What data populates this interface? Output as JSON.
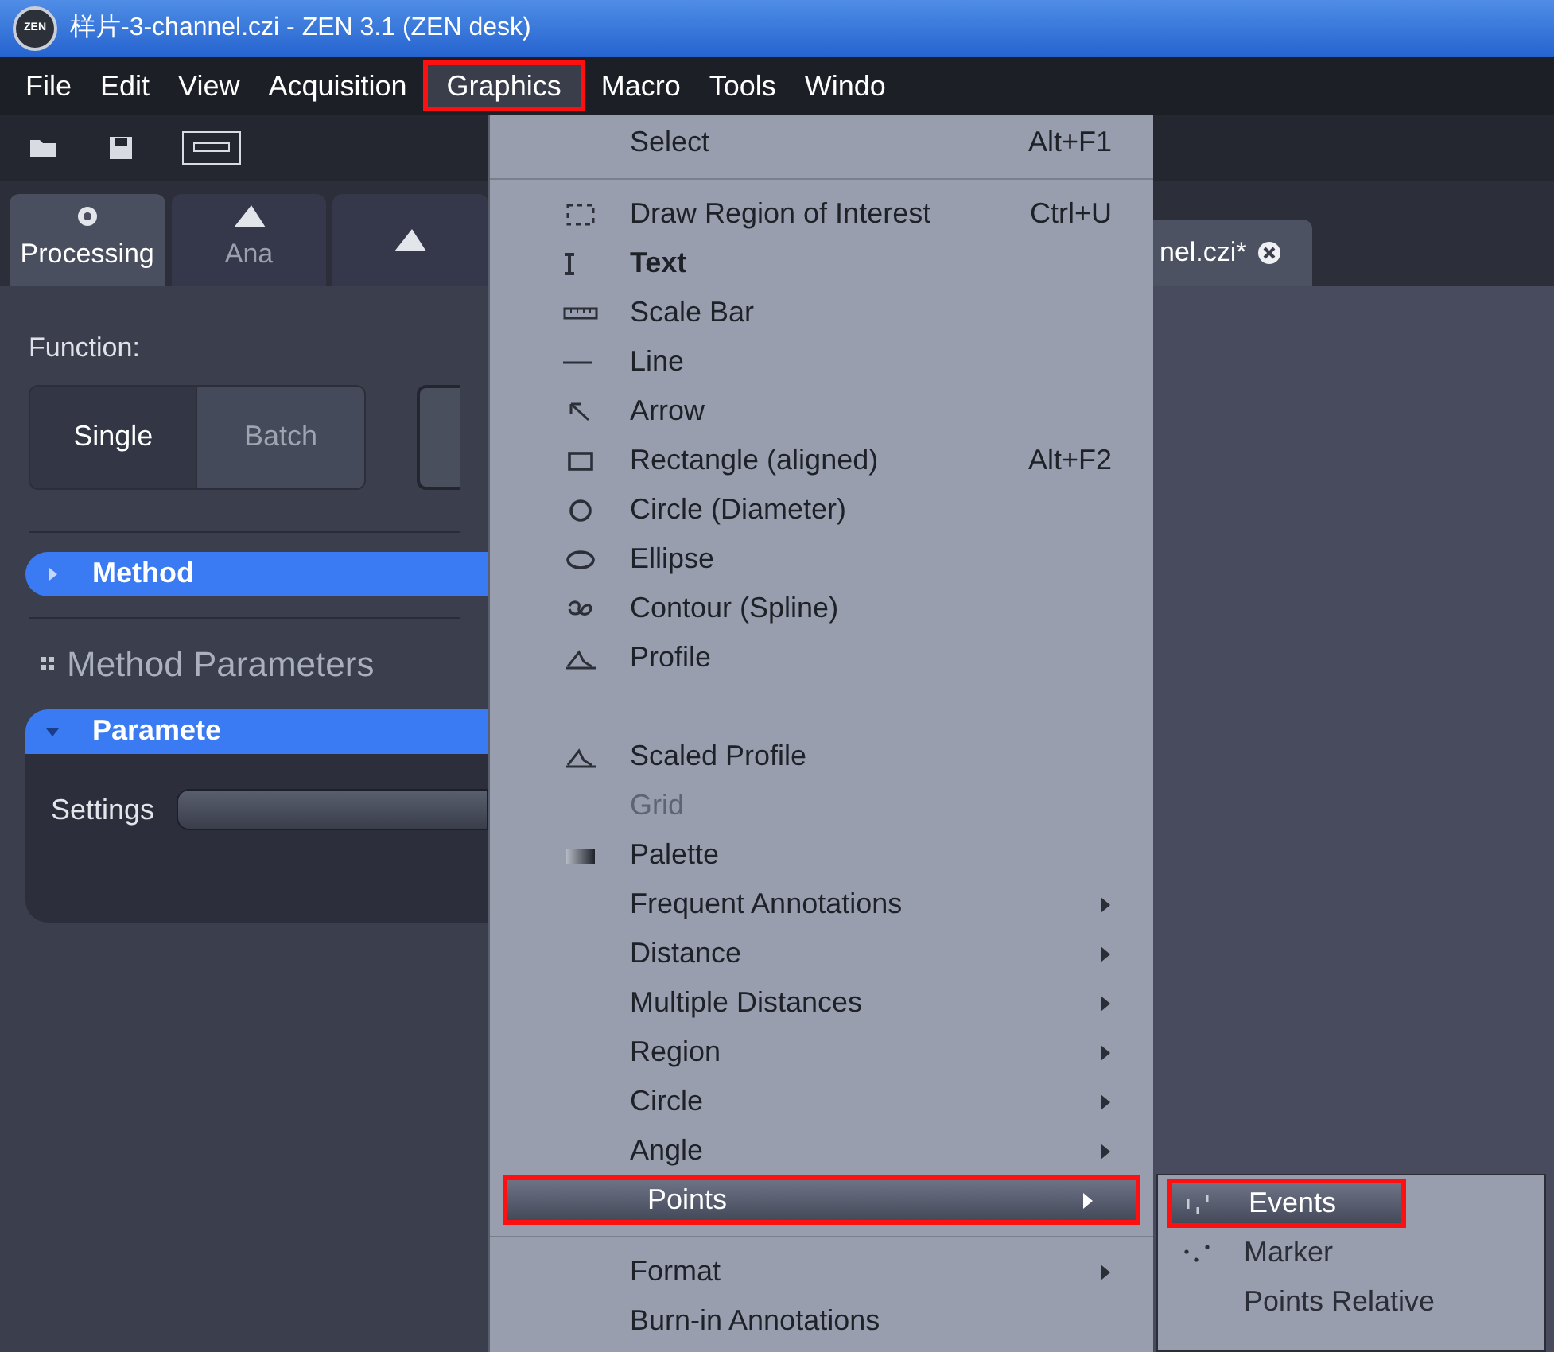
{
  "window": {
    "logo": "ZEN",
    "title": "样片-3-channel.czi - ZEN 3.1 (ZEN desk)"
  },
  "menu_bar": [
    {
      "label": "File",
      "selected": false
    },
    {
      "label": "Edit",
      "selected": false
    },
    {
      "label": "View",
      "selected": false
    },
    {
      "label": "Acquisition",
      "selected": false
    },
    {
      "label": "Graphics",
      "selected": true
    },
    {
      "label": "Macro",
      "selected": false
    },
    {
      "label": "Tools",
      "selected": false
    },
    {
      "label": "Windo",
      "selected": false
    }
  ],
  "tool_tabs": [
    {
      "label": "Processing",
      "selected": true
    },
    {
      "label": "Ana",
      "selected": false
    },
    {
      "selected": false
    }
  ],
  "document_tab": {
    "label": "nel.czi*"
  },
  "panel": {
    "function_label": "Function:",
    "function_buttons": [
      {
        "label": "Single",
        "selected": true
      },
      {
        "label": "Batch",
        "selected": false
      }
    ],
    "method": {
      "label": "Method",
      "expanded": false
    },
    "section_title": "Method Parameters",
    "parameters": {
      "label": "Paramete",
      "expanded": true
    },
    "settings": {
      "label": "Settings"
    }
  },
  "graphics_menu": [
    {
      "kind": "item",
      "label": "Select",
      "shortcut": "Alt+F1",
      "selected": false,
      "disabled": false,
      "bold": false
    },
    {
      "kind": "separator"
    },
    {
      "kind": "item",
      "label": "Draw Region of Interest",
      "shortcut": "Ctrl+U",
      "selected": false,
      "disabled": false,
      "bold": false
    },
    {
      "kind": "item",
      "label": "Text",
      "selected": false,
      "disabled": false,
      "bold": true
    },
    {
      "kind": "item",
      "label": "Scale Bar",
      "selected": false,
      "disabled": false,
      "bold": false
    },
    {
      "kind": "item",
      "label": "Line",
      "selected": false,
      "disabled": false,
      "bold": false
    },
    {
      "kind": "item",
      "label": "Arrow",
      "selected": false,
      "disabled": false,
      "bold": false
    },
    {
      "kind": "item",
      "label": "Rectangle (aligned)",
      "shortcut": "Alt+F2",
      "selected": false,
      "disabled": false,
      "bold": false
    },
    {
      "kind": "item",
      "label": "Circle (Diameter)",
      "selected": false,
      "disabled": false,
      "bold": false
    },
    {
      "kind": "item",
      "label": "Ellipse",
      "selected": false,
      "disabled": false,
      "bold": false
    },
    {
      "kind": "item",
      "label": "Contour (Spline)",
      "selected": false,
      "disabled": false,
      "bold": false
    },
    {
      "kind": "item",
      "label": "Profile",
      "selected": false,
      "disabled": false,
      "bold": false
    },
    {
      "kind": "blank"
    },
    {
      "kind": "item",
      "label": "Scaled Profile",
      "selected": false,
      "disabled": false,
      "bold": false
    },
    {
      "kind": "item",
      "label": "Grid",
      "selected": false,
      "disabled": true,
      "bold": false
    },
    {
      "kind": "item",
      "label": "Palette",
      "selected": false,
      "disabled": false,
      "bold": false
    },
    {
      "kind": "submenu",
      "label": "Frequent Annotations",
      "selected": false
    },
    {
      "kind": "submenu",
      "label": "Distance",
      "selected": false
    },
    {
      "kind": "submenu",
      "label": "Multiple Distances",
      "selected": false
    },
    {
      "kind": "submenu",
      "label": "Region",
      "selected": false
    },
    {
      "kind": "submenu",
      "label": "Circle",
      "selected": false
    },
    {
      "kind": "submenu",
      "label": "Angle",
      "selected": false
    },
    {
      "kind": "submenu",
      "label": "Points",
      "selected": true
    },
    {
      "kind": "separator"
    },
    {
      "kind": "submenu",
      "label": "Format",
      "selected": false
    },
    {
      "kind": "item",
      "label": "Burn-in Annotations",
      "selected": false,
      "disabled": false,
      "bold": false
    }
  ],
  "points_submenu": [
    {
      "label": "Events",
      "selected": true
    },
    {
      "label": "Marker",
      "selected": false
    },
    {
      "label": "Points Relative",
      "selected": false
    }
  ]
}
